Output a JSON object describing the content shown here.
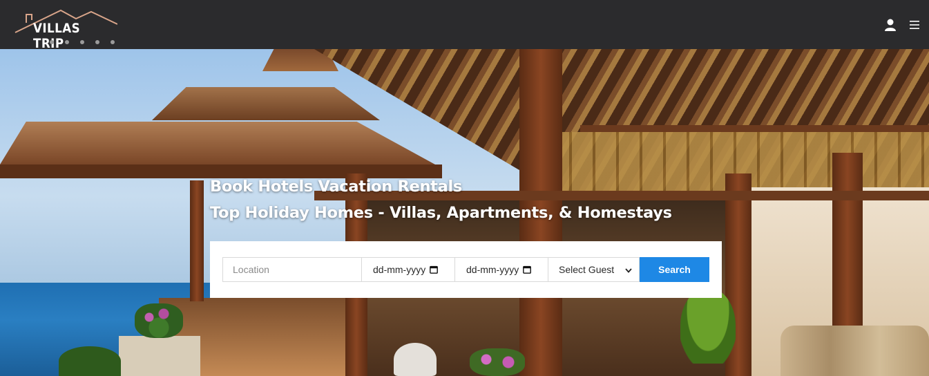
{
  "header": {
    "logo_text": "VILLAS TRIP",
    "user_icon": "user-icon",
    "menu_icon": "hamburger-menu-icon"
  },
  "hero": {
    "title_line1": "Book Hotels Vacation Rentals",
    "title_line2": "Top Holiday Homes - Villas, Apartments, & Homestays"
  },
  "search": {
    "location_placeholder": "Location",
    "checkin_value": "dd-mm-yyyy",
    "checkout_value": "dd-mm-yyyy",
    "guest_selected": "Select Guest",
    "search_label": "Search",
    "calendar_icon": "calendar-icon",
    "dropdown_icon": "chevron-down-icon"
  },
  "colors": {
    "header_bg": "#2b2b2d",
    "accent": "#1e88e5",
    "text_light": "#ffffff"
  }
}
